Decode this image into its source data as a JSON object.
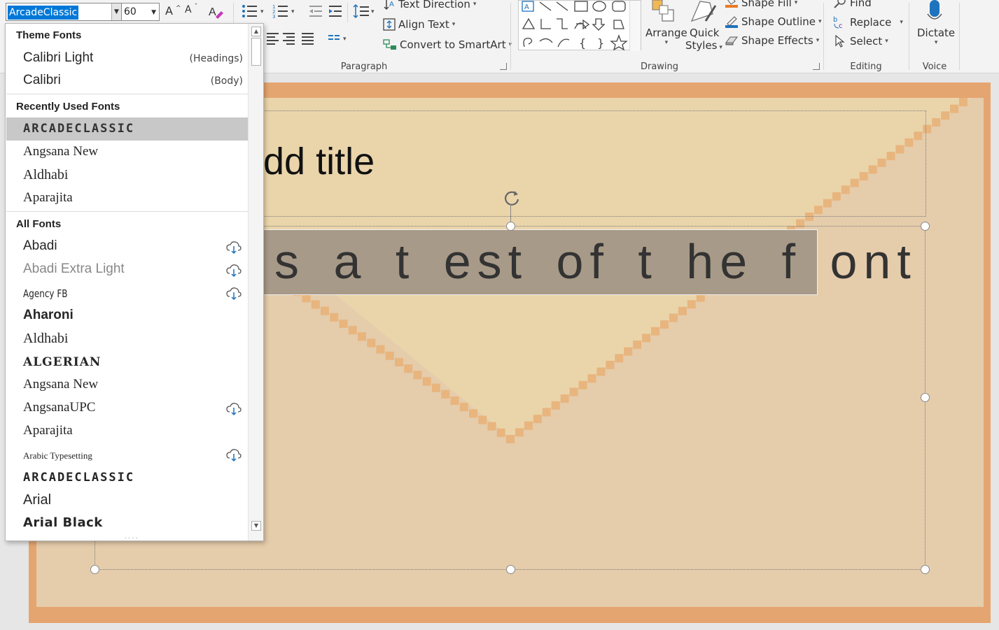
{
  "ribbon": {
    "font_name": "ArcadeClassic",
    "font_size": "60",
    "grow_font": "A",
    "shrink_font": "A",
    "text_direction": "Text Direction",
    "align_text": "Align Text",
    "convert_smartart": "Convert to SmartArt",
    "paragraph_label": "Paragraph",
    "arrange": "Arrange",
    "quick_styles_1": "Quick",
    "quick_styles_2": "Styles",
    "shape_fill": "Shape Fill",
    "shape_outline": "Shape Outline",
    "shape_effects": "Shape Effects",
    "drawing_label": "Drawing",
    "find": "Find",
    "replace": "Replace",
    "select": "Select",
    "editing_label": "Editing",
    "dictate": "Dictate",
    "voice_label": "Voice"
  },
  "slide": {
    "title_partial": "dd title",
    "body_partial": "s a t est  of  t he f ont"
  },
  "dropdown": {
    "theme_header": "Theme Fonts",
    "theme_fonts": [
      {
        "name": "Calibri Light",
        "tag": "(Headings)"
      },
      {
        "name": "Calibri",
        "tag": "(Body)"
      }
    ],
    "recent_header": "Recently Used Fonts",
    "recent_fonts": [
      "ARCADECLASSIC",
      "Angsana New",
      "Aldhabi",
      "Aparajita"
    ],
    "all_header": "All Fonts",
    "all_fonts": [
      "Abadi",
      "Abadi Extra Light",
      "Agency FB",
      "Aharoni",
      "Aldhabi",
      "ALGERIAN",
      "Angsana New",
      "AngsanaUPC",
      "Aparajita",
      "Arabic Typesetting",
      "ARCADECLASSIC",
      "Arial",
      "Arial Black"
    ],
    "grip": "....",
    "colors": {
      "selected": "#c8c8c8",
      "cloud": "#1e73be"
    }
  }
}
